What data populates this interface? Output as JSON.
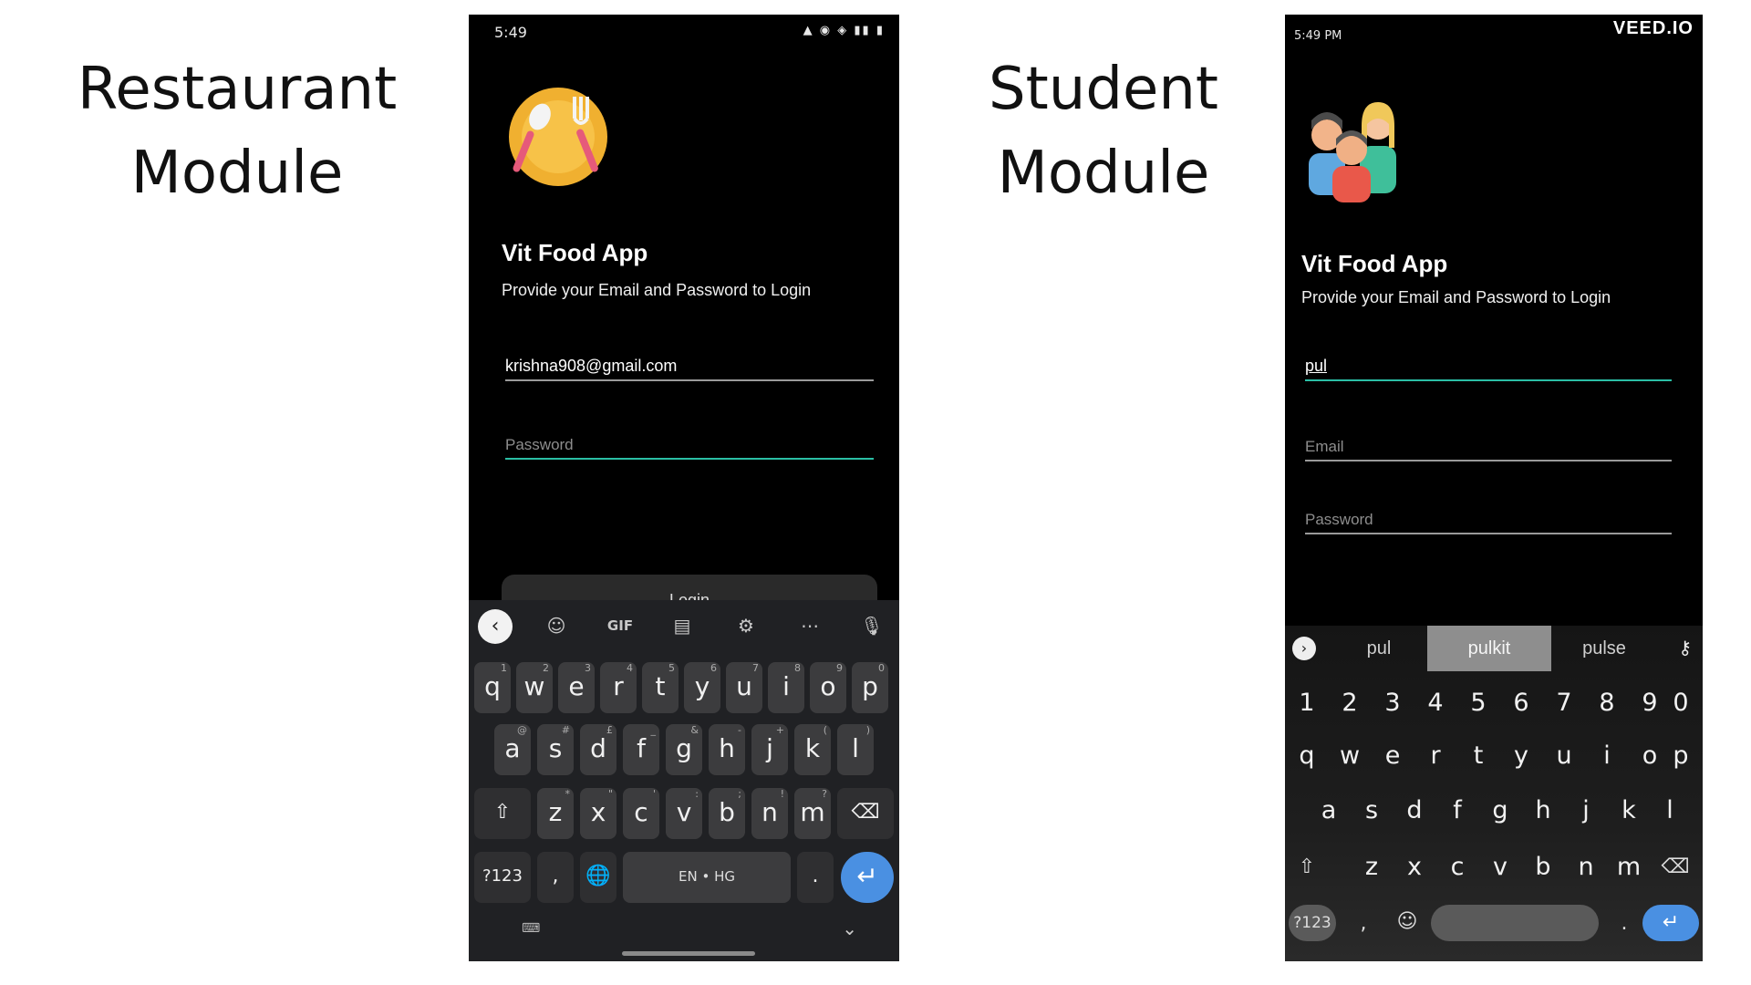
{
  "slide": {
    "left_title_line1": "Restaurant",
    "left_title_line2": "Module",
    "right_title_line1": "Student",
    "right_title_line2": "Module"
  },
  "restaurant_phone": {
    "status_time": "5:49",
    "app_title": "Vit Food App",
    "subtitle": "Provide your Email and Password to Login",
    "email_value": "krishna908@gmail.com",
    "password_placeholder": "Password",
    "login_label": "Login",
    "keyboard": {
      "toolbar": [
        "GIF"
      ],
      "row1": [
        "q",
        "w",
        "e",
        "r",
        "t",
        "y",
        "u",
        "i",
        "o",
        "p"
      ],
      "row1_hints": [
        "1",
        "2",
        "3",
        "4",
        "5",
        "6",
        "7",
        "8",
        "9",
        "0"
      ],
      "row2": [
        "a",
        "s",
        "d",
        "f",
        "g",
        "h",
        "j",
        "k",
        "l"
      ],
      "row2_hints": [
        "@",
        "#",
        "£",
        "_",
        "&",
        "-",
        "+",
        "(",
        ")"
      ],
      "row3": [
        "z",
        "x",
        "c",
        "v",
        "b",
        "n",
        "m"
      ],
      "row3_hints": [
        "*",
        "\"",
        "'",
        ":",
        ";",
        "!",
        "?"
      ],
      "symbols_label": "?123",
      "comma": ",",
      "space_label": "EN • HG",
      "period": "."
    }
  },
  "student_phone": {
    "status_time": "5:49 PM",
    "watermark": "VEED.IO",
    "app_title": "Vit Food App",
    "subtitle": "Provide your Email and Password to Login",
    "name_value": "pul",
    "email_placeholder": "Email",
    "password_placeholder": "Password",
    "keyboard": {
      "suggestions": [
        "pul",
        "pulkit",
        "pulse"
      ],
      "numbers": [
        "1",
        "2",
        "3",
        "4",
        "5",
        "6",
        "7",
        "8",
        "9",
        "0"
      ],
      "row1": [
        "q",
        "w",
        "e",
        "r",
        "t",
        "y",
        "u",
        "i",
        "o",
        "p"
      ],
      "row2": [
        "a",
        "s",
        "d",
        "f",
        "g",
        "h",
        "j",
        "k",
        "l"
      ],
      "row3": [
        "z",
        "x",
        "c",
        "v",
        "b",
        "n",
        "m"
      ],
      "symbols_label": "?123",
      "comma": ",",
      "period": "."
    }
  },
  "colors": {
    "accent_teal": "#2bbfa5",
    "enter_blue": "#4a90e2"
  }
}
